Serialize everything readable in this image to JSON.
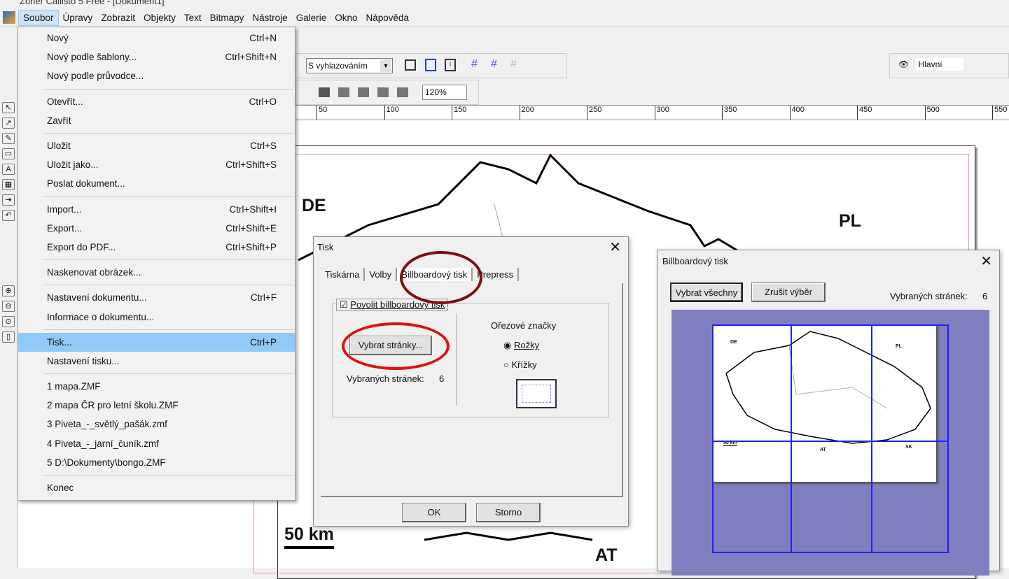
{
  "window": {
    "title": "Zoner Callisto 5 Free - [Dokument1]"
  },
  "menubar": [
    "Soubor",
    "Úpravy",
    "Zobrazit",
    "Objekty",
    "Text",
    "Bitmapy",
    "Nástroje",
    "Galerie",
    "Okno",
    "Nápověda"
  ],
  "file_menu": {
    "groups": [
      [
        {
          "label": "Nový",
          "shortcut": "Ctrl+N"
        },
        {
          "label": "Nový podle šablony...",
          "shortcut": "Ctrl+Shift+N"
        },
        {
          "label": "Nový podle průvodce...",
          "shortcut": ""
        }
      ],
      [
        {
          "label": "Otevřít...",
          "shortcut": "Ctrl+O"
        },
        {
          "label": "Zavřít",
          "shortcut": ""
        }
      ],
      [
        {
          "label": "Uložit",
          "shortcut": "Ctrl+S"
        },
        {
          "label": "Uložit jako...",
          "shortcut": "Ctrl+Shift+S"
        },
        {
          "label": "Poslat dokument...",
          "shortcut": ""
        }
      ],
      [
        {
          "label": "Import...",
          "shortcut": "Ctrl+Shift+I"
        },
        {
          "label": "Export...",
          "shortcut": "Ctrl+Shift+E"
        },
        {
          "label": "Export do PDF...",
          "shortcut": "Ctrl+Shift+P"
        }
      ],
      [
        {
          "label": "Naskenovat obrázek...",
          "shortcut": ""
        }
      ],
      [
        {
          "label": "Nastavení dokumentu...",
          "shortcut": "Ctrl+F"
        },
        {
          "label": "Informace o dokumentu...",
          "shortcut": ""
        }
      ],
      [
        {
          "label": "Tisk...",
          "shortcut": "Ctrl+P",
          "highlighted": true
        },
        {
          "label": "Nastavení tisku...",
          "shortcut": ""
        }
      ],
      [
        {
          "label": "1 mapa.ZMF",
          "shortcut": ""
        },
        {
          "label": "2 mapa ČR pro letní školu.ZMF",
          "shortcut": ""
        },
        {
          "label": "3 Piveta_-_světlý_pašák.zmf",
          "shortcut": ""
        },
        {
          "label": "4 Piveta_-_jarní_čuník.zmf",
          "shortcut": ""
        },
        {
          "label": "5 D:\\Dokumenty\\bongo.ZMF",
          "shortcut": ""
        }
      ],
      [
        {
          "label": "Konec",
          "shortcut": ""
        }
      ]
    ]
  },
  "toolbar": {
    "render_mode": "S vyhlazováním",
    "zoom": "120%",
    "layer": "Hlavní"
  },
  "ruler": {
    "ticks": [
      "50",
      "100",
      "150",
      "200",
      "250",
      "300",
      "350",
      "400",
      "450",
      "500",
      "550"
    ]
  },
  "map": {
    "labels": {
      "de": "DE",
      "pl": "PL",
      "at": "AT"
    },
    "scale": "50 km"
  },
  "print_dialog": {
    "title": "Tisk",
    "tabs": [
      "Tiskárna",
      "Volby",
      "Billboardový tisk",
      "Prepress"
    ],
    "active_tab": "Billboardový tisk",
    "enable_checkbox": {
      "label": "Povolit billboardový tisk",
      "checked": true
    },
    "select_pages_button": "Vybrat stránky...",
    "selected_pages_label": "Vybraných stránek:",
    "selected_pages_value": "6",
    "crop_marks": {
      "title": "Ořezové značky",
      "options": [
        "Rožky",
        "Křížky"
      ],
      "selected": "Rožky"
    },
    "ok": "OK",
    "cancel": "Storno",
    "highlight_colors": [
      "#7a1010",
      "#e01010"
    ]
  },
  "billboard_dialog": {
    "title": "Billboardový tisk",
    "select_all": "Vybrat všechny",
    "deselect": "Zrušit výběr",
    "selected_label": "Vybraných stránek:",
    "selected_value": "6",
    "preview": {
      "labels": {
        "de": "DE",
        "pl": "PL",
        "at": "AT",
        "sk": "SK"
      },
      "scale": "50 km",
      "background": "#7f7fbf",
      "grid_color": "#2020ff"
    }
  }
}
